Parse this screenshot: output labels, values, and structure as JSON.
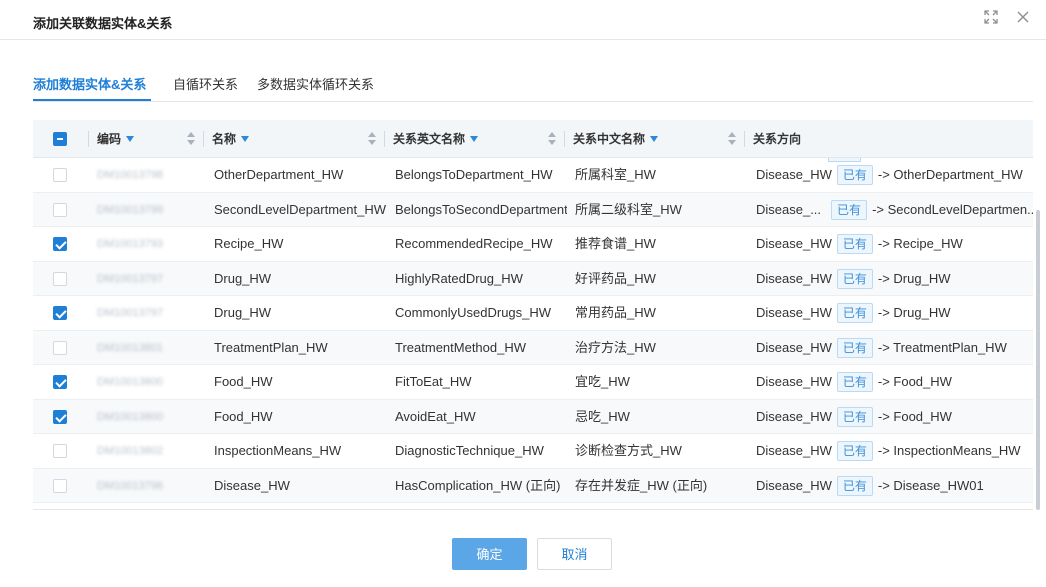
{
  "dialog": {
    "title": "添加关联数据实体&关系",
    "icons": [
      "expand-icon",
      "close-icon"
    ]
  },
  "tabs": [
    {
      "label": "添加数据实体&关系",
      "active": true
    },
    {
      "label": "自循环关系",
      "active": false
    },
    {
      "label": "多数据实体循环关系",
      "active": false
    }
  ],
  "table": {
    "header_checkbox": "indeterminate",
    "columns": {
      "code": "编码",
      "name": "名称",
      "rel_en": "关系英文名称",
      "rel_cn": "关系中文名称",
      "direction": "关系方向"
    },
    "rows": [
      {
        "checked": false,
        "code": "DM10013798",
        "name": "OtherDepartment_HW",
        "rel_en": "BelongsToDepartment_HW",
        "rel_cn": "所属科室_HW",
        "source": "Disease_HW",
        "tag": "已有",
        "target": "-> OtherDepartment_HW"
      },
      {
        "checked": false,
        "code": "DM10013799",
        "name": "SecondLevelDepartment_HW",
        "rel_en": "BelongsToSecondDepartment...",
        "rel_cn": "所属二级科室_HW",
        "source": "Disease_...",
        "tag": "已有",
        "target": "-> SecondLevelDepartmen..."
      },
      {
        "checked": true,
        "code": "DM10013793",
        "name": "Recipe_HW",
        "rel_en": "RecommendedRecipe_HW",
        "rel_cn": "推荐食谱_HW",
        "source": "Disease_HW",
        "tag": "已有",
        "target": "-> Recipe_HW"
      },
      {
        "checked": false,
        "code": "DM10013797",
        "name": "Drug_HW",
        "rel_en": "HighlyRatedDrug_HW",
        "rel_cn": "好评药品_HW",
        "source": "Disease_HW",
        "tag": "已有",
        "target": "-> Drug_HW"
      },
      {
        "checked": true,
        "code": "DM10013797",
        "name": "Drug_HW",
        "rel_en": "CommonlyUsedDrugs_HW",
        "rel_cn": "常用药品_HW",
        "source": "Disease_HW",
        "tag": "已有",
        "target": "-> Drug_HW"
      },
      {
        "checked": false,
        "code": "DM10013801",
        "name": "TreatmentPlan_HW",
        "rel_en": "TreatmentMethod_HW",
        "rel_cn": "治疗方法_HW",
        "source": "Disease_HW",
        "tag": "已有",
        "target": "-> TreatmentPlan_HW"
      },
      {
        "checked": true,
        "code": "DM10013800",
        "name": "Food_HW",
        "rel_en": "FitToEat_HW",
        "rel_cn": "宜吃_HW",
        "source": "Disease_HW",
        "tag": "已有",
        "target": "-> Food_HW"
      },
      {
        "checked": true,
        "code": "DM10013800",
        "name": "Food_HW",
        "rel_en": "AvoidEat_HW",
        "rel_cn": "忌吃_HW",
        "source": "Disease_HW",
        "tag": "已有",
        "target": "-> Food_HW"
      },
      {
        "checked": false,
        "code": "DM10013802",
        "name": "InspectionMeans_HW",
        "rel_en": "DiagnosticTechnique_HW",
        "rel_cn": "诊断检查方式_HW",
        "source": "Disease_HW",
        "tag": "已有",
        "target": "-> InspectionMeans_HW"
      },
      {
        "checked": false,
        "code": "DM10013796",
        "name": "Disease_HW",
        "rel_en": "HasComplication_HW (正向)",
        "rel_cn": "存在并发症_HW (正向)",
        "source": "Disease_HW",
        "tag": "已有",
        "target": "-> Disease_HW01"
      }
    ]
  },
  "footer": {
    "ok_label": "确定",
    "cancel_label": "取消"
  },
  "colors": {
    "accent": "#1f7fd6",
    "tag_bg": "#eef6fd",
    "header_bg": "#f3f6f9"
  }
}
